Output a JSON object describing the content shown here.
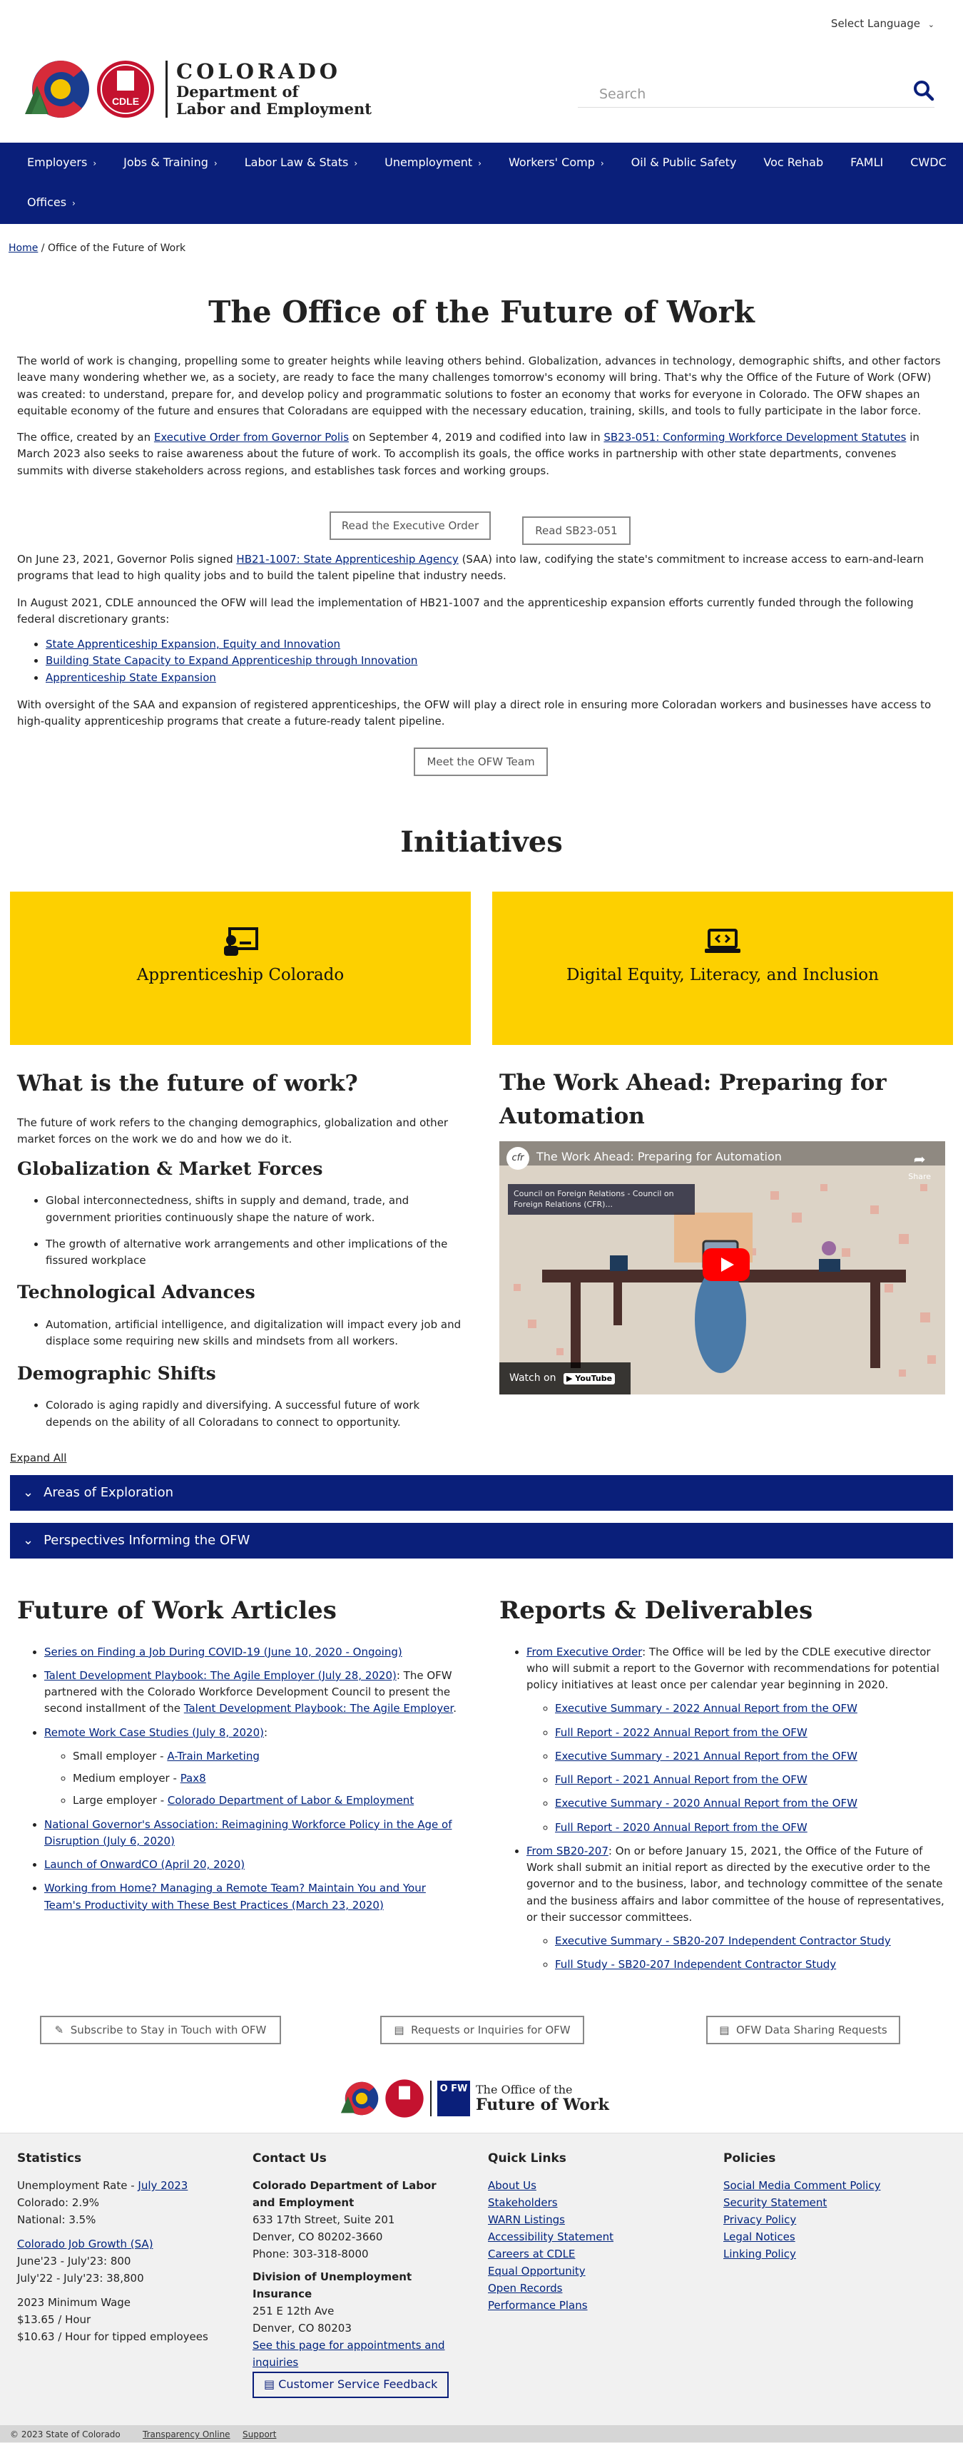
{
  "top": {
    "language": "Select Language"
  },
  "header": {
    "co": "COLORADO",
    "dept1": "Department of",
    "dept2": "Labor and Employment",
    "cdle": "CDLE",
    "search_placeholder": "Search"
  },
  "nav": {
    "row1": [
      {
        "label": "Employers",
        "chev": true
      },
      {
        "label": "Jobs & Training",
        "chev": true
      },
      {
        "label": "Labor Law & Stats",
        "chev": true
      },
      {
        "label": "Unemployment",
        "chev": true
      },
      {
        "label": "Workers' Comp",
        "chev": true
      },
      {
        "label": "Oil & Public Safety",
        "chev": false
      },
      {
        "label": "Voc Rehab",
        "chev": false
      },
      {
        "label": "FAMLI",
        "chev": false
      },
      {
        "label": "CWDC",
        "chev": false
      }
    ],
    "row2": [
      {
        "label": "Offices",
        "chev": true
      }
    ]
  },
  "breadcrumb": {
    "home": "Home",
    "sep": "/",
    "current": "Office of the Future of Work"
  },
  "page_title": "The Office of the Future of Work",
  "intro": {
    "p1": "The world of work is changing, propelling some to greater heights while leaving others behind. Globalization, advances in technology, demographic shifts, and other factors leave many wondering whether we, as a society, are ready to face the many challenges tomorrow's economy will bring. That's why the Office of the Future of Work (OFW) was created: to understand, prepare for, and develop policy and programmatic solutions to foster an economy that works for everyone in Colorado. The OFW shapes an equitable economy of the future and ensures that Coloradans are equipped with the necessary education, training, skills, and tools to fully participate in the labor force.",
    "p2a": "The office, created by an ",
    "p2_link1": "Executive Order from Governor Polis",
    "p2b": " on September 4, 2019 and codified into law in ",
    "p2_link2": "SB23-051: Conforming Workforce Development Statutes",
    "p2c": " in March 2023 also seeks to raise awareness about the future of work. To accomplish its goals, the office works in partnership with other state departments, convenes summits with diverse stakeholders across regions, and establishes task forces and working groups.",
    "btn_exec": "Read the Executive Order",
    "btn_sb": "Read SB23-051",
    "p3a": "On June 23, 2021, Governor Polis signed ",
    "p3_link": "HB21-1007: State Apprenticeship Agency",
    "p3b": " (SAA) into law, codifying the state's commitment to increase access to earn-and-learn programs that lead to high quality jobs and to build the talent pipeline that industry needs.",
    "p4": "In August 2021, CDLE announced the OFW will lead the implementation of HB21-1007 and the apprenticeship expansion efforts currently funded through the following federal discretionary grants:",
    "grants": [
      "State Apprenticeship Expansion, Equity and Innovation",
      "Building State Capacity to Expand Apprenticeship through Innovation",
      "Apprenticeship State Expansion"
    ],
    "p5": "With oversight of the SAA and expansion of registered apprenticeships, the OFW will play a direct role in ensuring more Coloradan workers and businesses have access to high-quality apprenticeship programs that create a future-ready talent pipeline.",
    "btn_team": "Meet the OFW Team"
  },
  "initiatives": {
    "title": "Initiatives",
    "cards": [
      {
        "label": "Apprenticeship Colorado",
        "icon": "presenter-icon"
      },
      {
        "label": "Digital Equity, Literacy, and Inclusion",
        "icon": "laptop-code-icon"
      }
    ]
  },
  "future": {
    "title": "What is the future of work?",
    "intro": "The future of work refers to the changing demographics, globalization and other market forces on the work we do and how we do it.",
    "sections": [
      {
        "h": "Globalization & Market Forces",
        "items": [
          "Global interconnectedness, shifts in supply and demand, trade, and government priorities continuously shape the nature of work.",
          "The growth of alternative work arrangements and other implications of the fissured workplace"
        ]
      },
      {
        "h": "Technological Advances",
        "items": [
          "Automation, artificial intelligence, and digitalization will impact every job and displace some requiring new skills and mindsets from all workers."
        ]
      },
      {
        "h": "Demographic Shifts",
        "items": [
          "Colorado is aging rapidly and diversifying. A successful future of work depends on the ability of all Coloradans to connect to opportunity."
        ]
      }
    ]
  },
  "video": {
    "heading": "The Work Ahead: Preparing for Automation",
    "title": "The Work Ahead: Preparing for Automation",
    "channel": "Council on Foreign Relations - Council on Foreign Relations (CFR)...",
    "share": "Share",
    "watch_on": "Watch on",
    "yt": "YouTube",
    "cfr": "cfr"
  },
  "expand_all": "Expand All",
  "accordions": [
    "Areas of Exploration",
    "Perspectives Informing the OFW"
  ],
  "articles": {
    "title": "Future of Work Articles",
    "items": [
      {
        "link": "Series on Finding a Job During COVID-19 (June 10, 2020 - Ongoing)",
        "rest": ""
      },
      {
        "link": "Talent Development Playbook: The Agile Employer (July 28, 2020)",
        "rest": ": The OFW partnered with the Colorado Workforce Development Council to present the second installment of the ",
        "link2": "Talent Development Playbook: The Agile Employer",
        "end": "."
      },
      {
        "link": "Remote Work Case Studies (July 8, 2020)",
        "rest": ":",
        "sub": [
          {
            "t": "Small employer - ",
            "l": "A-Train Marketing"
          },
          {
            "t": "Medium employer - ",
            "l": "Pax8"
          },
          {
            "t": "Large employer - ",
            "l": "Colorado Department of Labor & Employment"
          }
        ]
      },
      {
        "link": "National Governor's Association: Reimagining Workforce Policy in the Age of Disruption (July 6, 2020)",
        "rest": ""
      },
      {
        "link": "Launch of OnwardCO (April 20, 2020)",
        "rest": ""
      },
      {
        "link": "Working from Home? Managing a Remote Team? Maintain You and Your Team's Productivity with These Best Practices (March 23, 2020)",
        "rest": ""
      }
    ]
  },
  "reports": {
    "title": "Reports & Deliverables",
    "eo_link": "From Executive Order",
    "eo_text": ": The Office will be led by the CDLE executive director who will submit a report to the Governor with recommendations for potential policy initiatives at least once per calendar year beginning in 2020.",
    "eo_items": [
      "Executive Summary - 2022 Annual Report from the OFW",
      "Full Report - 2022 Annual Report from the OFW",
      "Executive Summary - 2021 Annual Report from the OFW",
      "Full Report - 2021 Annual Report from the OFW",
      "Executive Summary - 2020 Annual Report from the OFW",
      "Full Report - 2020 Annual Report from the OFW"
    ],
    "sb_link": "From SB20-207",
    "sb_text": ": On or before January 15, 2021, the Office of the Future of Work shall submit an initial report as directed by the executive order to the governor and to the business, labor, and technology committee of the senate and the business affairs and labor committee of the house of representatives, or their successor committees.",
    "sb_items": [
      "Executive Summary - SB20-207 Independent Contractor Study",
      "Full Study - SB20-207 Independent Contractor Study"
    ]
  },
  "cta": {
    "subscribe": "Subscribe to Stay in Touch with OFW",
    "requests": "Requests or Inquiries for OFW",
    "data": "OFW Data Sharing Requests"
  },
  "footer_logo": {
    "line1": "The Office of the",
    "line2": "Future of Work",
    "badge": "O FW"
  },
  "footer": {
    "stats": {
      "h": "Statistics",
      "unemp": "Unemployment Rate - ",
      "unemp_link": "July 2023",
      "co": "Colorado: 2.9%",
      "nat": "National: 3.5%",
      "growth_link": "Colorado Job Growth (SA)",
      "g1": "June'23 - July'23: 800",
      "g2": "July'22 - July'23: 38,800",
      "wage_h": "2023 Minimum Wage",
      "w1": "$13.65 / Hour",
      "w2": "$10.63 / Hour for tipped employees"
    },
    "contact": {
      "h": "Contact Us",
      "org": "Colorado Department of Labor and Employment",
      "a1": "633 17th Street, Suite 201",
      "a2": "Denver, CO  80202-3660",
      "phone": "Phone: 303-318-8000",
      "div": "Division of Unemployment Insurance",
      "b1": "251 E 12th Ave",
      "b2": "Denver, CO  80203",
      "appt": "See this page for appointments and inquiries",
      "feedback": "Customer Service Feedback"
    },
    "quick": {
      "h": "Quick Links",
      "items": [
        "About Us",
        "Stakeholders",
        "WARN Listings",
        "Accessibility Statement",
        "Careers at CDLE",
        "Equal Opportunity",
        "Open Records",
        "Performance Plans"
      ]
    },
    "policies": {
      "h": "Policies",
      "items": [
        "Social Media Comment Policy",
        "Security Statement",
        "Privacy Policy",
        "Legal Notices",
        "Linking Policy"
      ]
    }
  },
  "bottom": {
    "copy": "© 2023 State of Colorado",
    "t1": "Transparency Online",
    "t2": "Support"
  },
  "colors": {
    "navy": "#0a1f7a",
    "yellow": "#fdd000"
  }
}
